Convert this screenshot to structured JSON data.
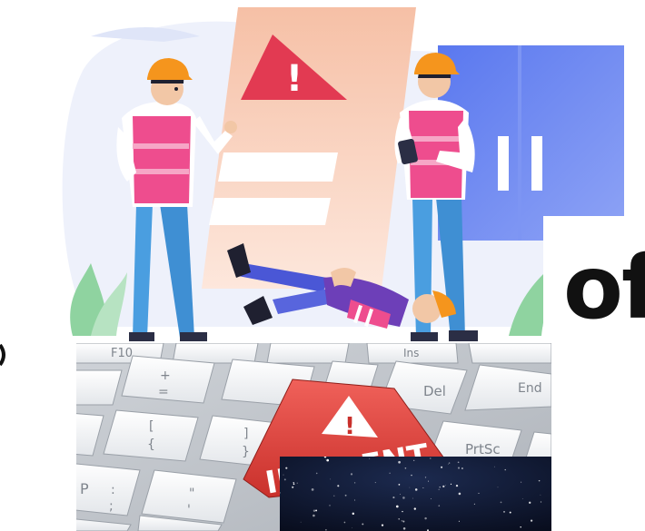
{
  "illustration": {
    "warning_glyph": "!",
    "colors": {
      "vest": "#ee4d8e",
      "helmet": "#f5951d",
      "pants": "#4a9ee0",
      "alert": "#e23a52",
      "door": "#5c7cf0"
    }
  },
  "word_fragment": "of",
  "keyboard": {
    "keys": {
      "f10": "F10",
      "end": "End",
      "del": "Del",
      "prtsc": "PrtSc",
      "ins": "Ins",
      "plus": "+",
      "equals": "=",
      "bracket_open": "[",
      "brace_open": "{",
      "bracket_close": "]",
      "brace_close": "}",
      "p": "P",
      "colon": ":",
      "semicolon": ";",
      "quote": "\"",
      "apostrophe": "'"
    },
    "incident_label": "INCIDENT",
    "alert_glyph": "!"
  }
}
